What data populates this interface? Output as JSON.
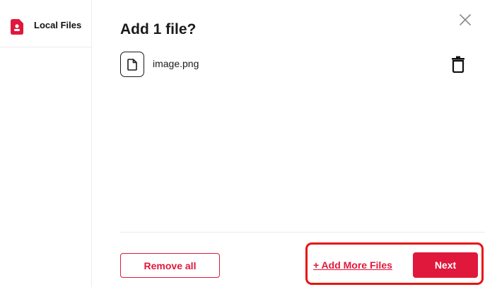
{
  "sidebar": {
    "items": [
      {
        "label": "Local Files",
        "icon": "local-file-icon",
        "active": true
      }
    ]
  },
  "dialog": {
    "title": "Add 1 file?",
    "close_icon": "close-icon"
  },
  "files": [
    {
      "name": "image.png",
      "icon": "file-icon",
      "action_icon": "trash-icon"
    }
  ],
  "footer": {
    "remove_all_label": "Remove all",
    "add_more_label": "+ Add More Files",
    "next_label": "Next"
  },
  "colors": {
    "accent": "#e0183c",
    "highlight": "#e8140f",
    "text": "#1a1a1a",
    "divider": "#ececec"
  }
}
